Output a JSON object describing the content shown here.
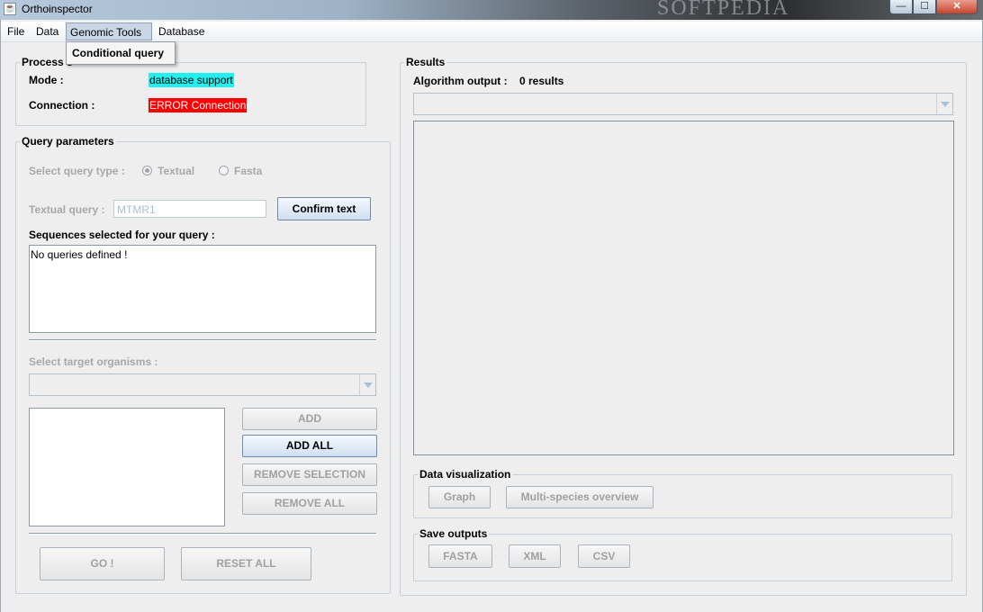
{
  "window": {
    "title": "Orthoinspector",
    "watermark": "SOFTPEDIA"
  },
  "menubar": {
    "items": [
      "File",
      "Data",
      "Genomic Tools",
      "Database"
    ]
  },
  "dropdown": {
    "item": "Conditional query"
  },
  "process": {
    "legend": "Process s",
    "mode_label": "Mode :",
    "mode_value": "database support",
    "connection_label": "Connection :",
    "connection_value": "ERROR Connection",
    "colors": {
      "mode_bg": "#21f0f0",
      "connection_bg": "#ff0000"
    }
  },
  "query": {
    "legend": "Query parameters",
    "type_label": "Select query type :",
    "options": [
      "Textual",
      "Fasta"
    ],
    "selected_option": "Textual",
    "textual_label": "Textual query :",
    "textual_value": "MTMR1",
    "confirm_label": "Confirm text",
    "sequences_label": "Sequences selected for your query :",
    "sequences_text": "No queries defined !",
    "target_label": "Select target organisms :",
    "add_label": "ADD",
    "add_all_label": "ADD ALL",
    "remove_selection_label": "REMOVE SELECTION",
    "remove_all_label": "REMOVE ALL",
    "go_label": "GO !",
    "reset_label": "RESET ALL"
  },
  "results": {
    "legend": "Results",
    "algo_label": "Algorithm output :",
    "algo_value": "0 results",
    "dataviz_legend": "Data visualization",
    "graph_label": "Graph",
    "multi_label": "Multi-species overview",
    "save_legend": "Save outputs",
    "fasta_label": "FASTA",
    "xml_label": "XML",
    "csv_label": "CSV"
  }
}
